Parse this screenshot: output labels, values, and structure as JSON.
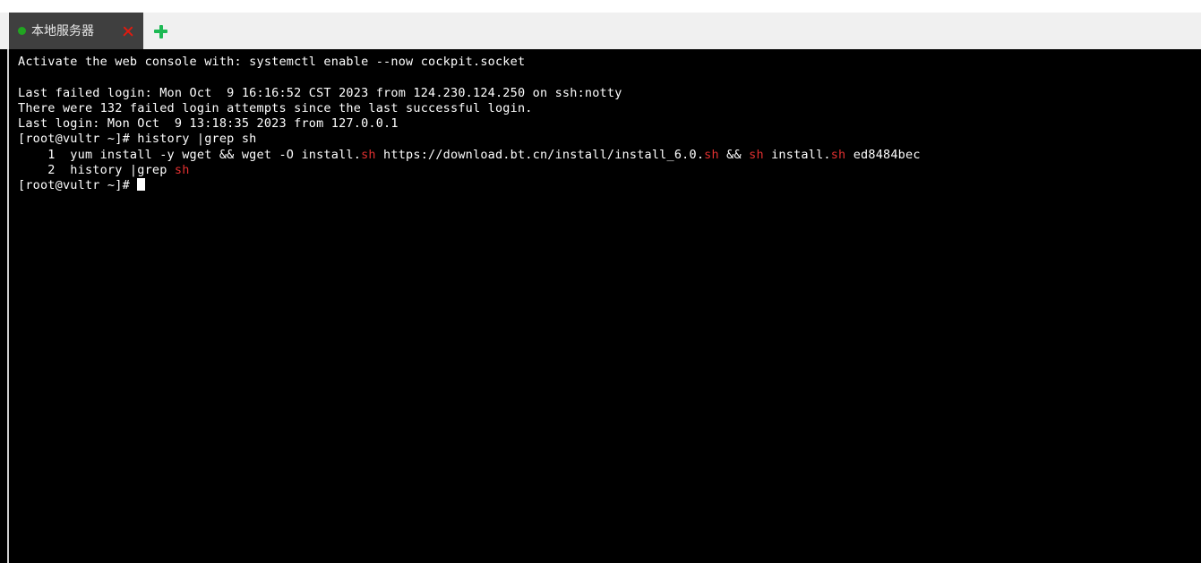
{
  "window": {
    "tabbar": {
      "tabs": [
        {
          "label": "本地服务器",
          "status_dot": "green-status-dot",
          "close_icon": "close-icon",
          "active": true
        }
      ],
      "new_tab_icon": "plus-icon",
      "background_color": "#f0f0f0",
      "active_tab_color": "#3f3f3f"
    }
  },
  "terminal": {
    "background_color": "#000000",
    "foreground_color": "#ffffff",
    "highlight_color": "#e03030",
    "cursor": "block-cursor",
    "lines": [
      {
        "id": "line-activate",
        "text": "Activate the web console with: systemctl enable --now cockpit.socket"
      },
      {
        "id": "line-blank-1",
        "text": " "
      },
      {
        "id": "line-last-failed-login",
        "text": "Last failed login: Mon Oct  9 16:16:52 CST 2023 from 124.230.124.250 on ssh:notty"
      },
      {
        "id": "line-failed-attempts",
        "text": "There were 132 failed login attempts since the last successful login."
      },
      {
        "id": "line-last-login",
        "text": "Last login: Mon Oct  9 13:18:35 2023 from 127.0.0.1"
      },
      {
        "id": "line-prompt-history",
        "text": "[root@vultr ~]# history |grep sh"
      },
      {
        "id": "line-history-1",
        "segments": [
          {
            "text": "    1  yum install -y wget && wget -O install.",
            "color": "fg"
          },
          {
            "text": "sh",
            "color": "highlight"
          },
          {
            "text": " https://download.bt.cn/install/install_6.0.",
            "color": "fg"
          },
          {
            "text": "sh",
            "color": "highlight"
          },
          {
            "text": " && ",
            "color": "fg"
          },
          {
            "text": "sh",
            "color": "highlight"
          },
          {
            "text": " install.",
            "color": "fg"
          },
          {
            "text": "sh",
            "color": "highlight"
          },
          {
            "text": " ed8484bec",
            "color": "fg"
          }
        ]
      },
      {
        "id": "line-history-2",
        "segments": [
          {
            "text": "    2  history |grep ",
            "color": "fg"
          },
          {
            "text": "sh",
            "color": "highlight"
          }
        ]
      },
      {
        "id": "line-prompt-current",
        "text": "[root@vultr ~]# ",
        "cursor": true
      }
    ]
  }
}
